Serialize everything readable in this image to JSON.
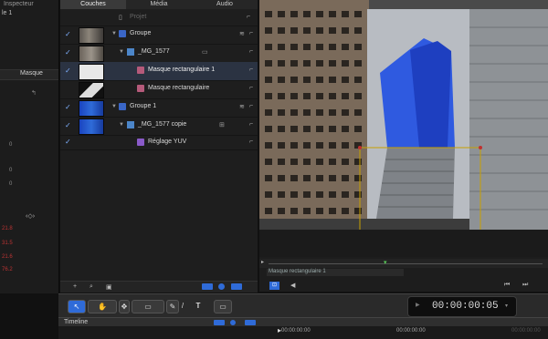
{
  "inspector": {
    "title": "Inspecteur",
    "subtitle": "le 1",
    "tab": "Masque",
    "values": [
      "0",
      "0",
      "0"
    ],
    "red_values": [
      "21.8",
      "31.5",
      "21.6",
      "76.2"
    ]
  },
  "tabs": [
    "Couches",
    "Média",
    "Audio"
  ],
  "layers": {
    "header_label": "Projet",
    "rows": [
      {
        "label": "Groupe",
        "checked": true
      },
      {
        "label": "_MG_1577",
        "checked": true
      },
      {
        "label": "Masque rectangulaire 1",
        "checked": true,
        "selected": true
      },
      {
        "label": "Masque rectangulaire",
        "checked": false
      },
      {
        "label": "Groupe 1",
        "checked": true
      },
      {
        "label": "_MG_1577 copie",
        "checked": true
      },
      {
        "label": "Réglage YUV",
        "checked": true
      }
    ]
  },
  "canvas": {
    "mini_label": "Masque rectangulaire 1"
  },
  "timecode": "00:00:00:05",
  "timeline": {
    "label": "Timeline",
    "ruler_start": "00:00:00:00",
    "ruler_mid": "00:00:00:00",
    "ruler_end": "00:00:00:00"
  },
  "colors": {
    "accent": "#2f6bd8",
    "selection": "#2b3342",
    "mask_line": "#c8a000"
  }
}
